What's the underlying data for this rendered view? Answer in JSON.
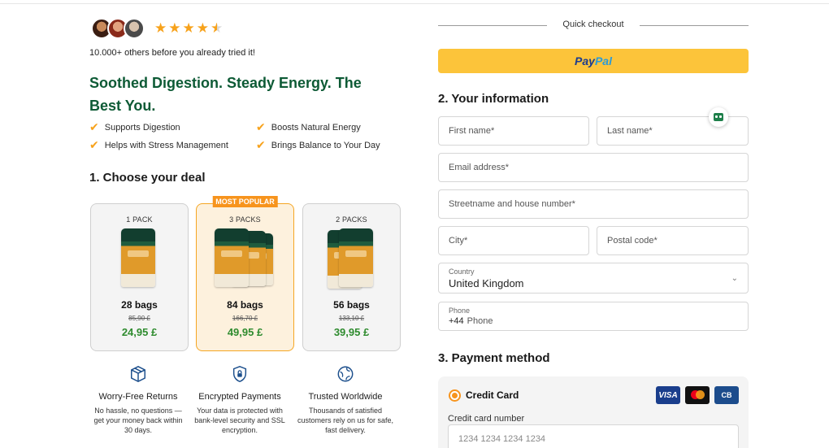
{
  "reviews": {
    "rating_stars": 4.5,
    "note": "10.000+ others before you already tried it!"
  },
  "headline": "Soothed Digestion. Steady Energy. The Best You.",
  "benefits": [
    "Supports Digestion",
    "Boosts Natural Energy",
    "Helps with Stress Management",
    "Brings Balance to Your Day"
  ],
  "deal_section_title": "1. Choose your deal",
  "deals": [
    {
      "pack": "1 PACK",
      "bags": "28 bags",
      "old_price": "85,90 £",
      "price": "24,95 £",
      "badge": ""
    },
    {
      "pack": "3 PACKS",
      "bags": "84 bags",
      "old_price": "166,70 £",
      "price": "49,95 £",
      "badge": "MOST POPULAR"
    },
    {
      "pack": "2 PACKS",
      "bags": "56 bags",
      "old_price": "133,10 £",
      "price": "39,95 £",
      "badge": ""
    }
  ],
  "features": [
    {
      "icon": "box-return-icon",
      "title": "Worry-Free Returns",
      "desc": "No hassle, no questions — get your money back within 30 days."
    },
    {
      "icon": "shield-lock-icon",
      "title": "Encrypted Payments",
      "desc": "Your data is protected with bank-level security and SSL encryption."
    },
    {
      "icon": "globe-check-icon",
      "title": "Trusted Worldwide",
      "desc": "Thousands of satisfied customers rely on us for safe, fast delivery."
    }
  ],
  "checkout": {
    "quick_label": "Quick checkout",
    "paypal_part1": "Pay",
    "paypal_part2": "Pal"
  },
  "info_section_title": "2. Your information",
  "form": {
    "first_name": "First name*",
    "last_name": "Last name*",
    "email": "Email address*",
    "street": "Streetname and house number*",
    "city": "City*",
    "postal": "Postal code*",
    "country_label": "Country",
    "country_value": "United Kingdom",
    "phone_label": "Phone",
    "phone_prefix": "+44",
    "phone_placeholder": "Phone"
  },
  "payment_section_title": "3. Payment method",
  "payment": {
    "method": "Credit Card",
    "card_number_label": "Credit card number",
    "card_number_placeholder": "1234 1234 1234 1234",
    "brands": [
      "VISA",
      "Mastercard",
      "CB"
    ]
  },
  "colors": {
    "brand_green": "#0d5a35",
    "accent_orange": "#f7941d",
    "price_green": "#2e8b2e",
    "paypal_yellow": "#fcc43a"
  }
}
